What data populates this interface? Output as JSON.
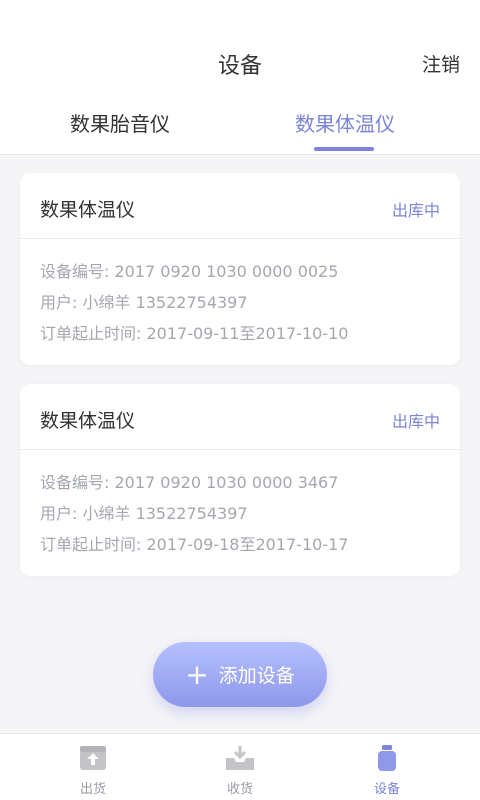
{
  "header": {
    "title": "设备",
    "logout_label": "注销"
  },
  "tabs": [
    {
      "label": "数果胎音仪",
      "active": false
    },
    {
      "label": "数果体温仪",
      "active": true
    }
  ],
  "devices": [
    {
      "name": "数果体温仪",
      "status": "出库中",
      "serial_line": "设备编号: 2017 0920 1030 0000 0025",
      "user_line": "用户: 小绵羊 13522754397",
      "period_line": "订单起止时间: 2017-09-11至2017-10-10"
    },
    {
      "name": "数果体温仪",
      "status": "出库中",
      "serial_line": "设备编号: 2017 0920 1030 0000 3467",
      "user_line": "用户: 小绵羊 13522754397",
      "period_line": "订单起止时间: 2017-09-18至2017-10-17"
    }
  ],
  "add_button": {
    "plus": "+",
    "label": "添加设备"
  },
  "bottom_nav": [
    {
      "label": "出货",
      "icon": "box-upload-icon",
      "active": false
    },
    {
      "label": "收货",
      "icon": "tray-download-icon",
      "active": false
    },
    {
      "label": "设备",
      "icon": "device-jar-icon",
      "active": true
    }
  ],
  "colors": {
    "accent": "#7b84d8",
    "muted": "#a4a7ae",
    "nav_inactive": "#c4c4c8"
  }
}
